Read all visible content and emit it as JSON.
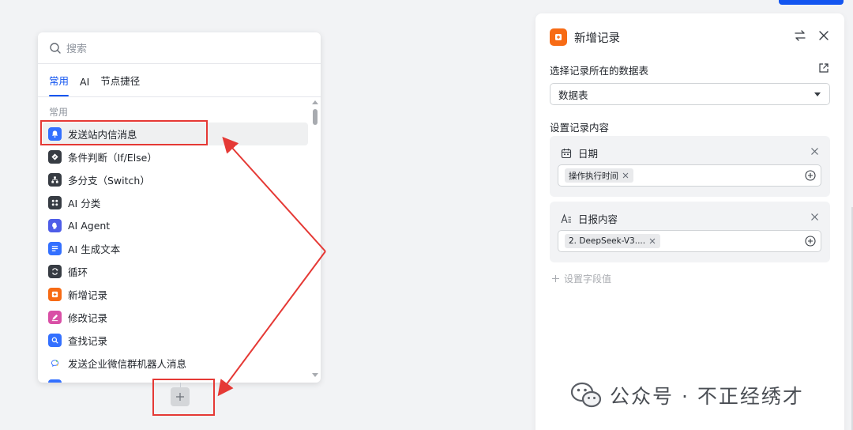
{
  "picker": {
    "search_placeholder": "搜索",
    "tabs": [
      {
        "label": "常用",
        "active": true
      },
      {
        "label": "AI",
        "active": false
      },
      {
        "label": "节点捷径",
        "active": false
      }
    ],
    "section_title": "常用",
    "items": [
      {
        "label": "发送站内信消息",
        "icon": "bell-icon",
        "color": "#3370ff"
      },
      {
        "label": "条件判断（If/Else）",
        "icon": "diamond-branch-icon",
        "color": "#373c43"
      },
      {
        "label": "多分支（Switch）",
        "icon": "org-branch-icon",
        "color": "#373c43"
      },
      {
        "label": "AI 分类",
        "icon": "grid-dots-icon",
        "color": "#373c43"
      },
      {
        "label": "AI Agent",
        "icon": "agent-head-icon",
        "color": "#4e5de8"
      },
      {
        "label": "AI 生成文本",
        "icon": "text-lines-icon",
        "color": "#3370ff"
      },
      {
        "label": "循环",
        "icon": "loop-icon",
        "color": "#373c43"
      },
      {
        "label": "新增记录",
        "icon": "add-record-icon",
        "color": "#f76b15"
      },
      {
        "label": "修改记录",
        "icon": "pencil-icon",
        "color": "#d94fa6"
      },
      {
        "label": "查找记录",
        "icon": "search-record-icon",
        "color": "#3370ff"
      },
      {
        "label": "发送企业微信群机器人消息",
        "icon": "chat-bubble-icon",
        "color": "#ffffff"
      }
    ]
  },
  "panel": {
    "title": "新增记录",
    "table_label": "选择记录所在的数据表",
    "table_value": "数据表",
    "content_label": "设置记录内容",
    "fields": [
      {
        "name": "日期",
        "icon": "calendar-icon",
        "chip": "操作执行时间"
      },
      {
        "name": "日报内容",
        "icon": "text-field-icon",
        "chip": "2. DeepSeek-V3...."
      }
    ],
    "add_field_label": "设置字段值"
  },
  "watermark": {
    "text": "公众号 · 不正经绣才"
  },
  "colors": {
    "accent": "#1456f0",
    "annotation_red": "#e53935",
    "record_orange": "#f76b15"
  }
}
